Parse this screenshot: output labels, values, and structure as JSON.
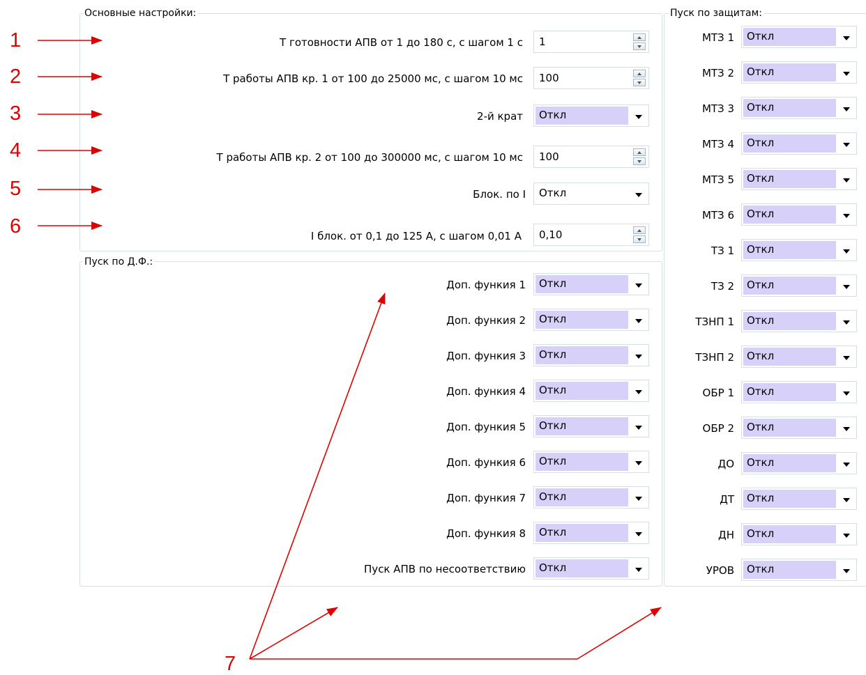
{
  "main_settings": {
    "legend": "Основные настройки:",
    "rows": [
      {
        "label": "Т готовности АПВ от 1 до 180 с, с шагом 1 с",
        "value": "1"
      },
      {
        "label": "Т работы АПВ кр. 1 от 100 до 25000 мс, с шагом 10 мс",
        "value": "100"
      },
      {
        "label": "2-й крат",
        "value": "Откл"
      },
      {
        "label": "Т работы АПВ кр. 2 от 100 до 300000 мс, с шагом 10 мс",
        "value": "100"
      },
      {
        "label": "Блок. по I",
        "value": "Откл"
      },
      {
        "label": "I блок. от 0,1 до 125 А, с шагом 0,01 А",
        "value": "0,10"
      }
    ]
  },
  "df_start": {
    "legend": "Пуск по Д.Ф.:",
    "rows": [
      {
        "label": "Доп. функия 1",
        "value": "Откл"
      },
      {
        "label": "Доп. функия 2",
        "value": "Откл"
      },
      {
        "label": "Доп. функия 3",
        "value": "Откл"
      },
      {
        "label": "Доп. функия 4",
        "value": "Откл"
      },
      {
        "label": "Доп. функия 5",
        "value": "Откл"
      },
      {
        "label": "Доп. функия 6",
        "value": "Откл"
      },
      {
        "label": "Доп. функия 7",
        "value": "Откл"
      },
      {
        "label": "Доп. функия 8",
        "value": "Откл"
      },
      {
        "label": "Пуск АПВ по несоответствию",
        "value": "Откл"
      }
    ]
  },
  "protection_start": {
    "legend": "Пуск по защитам:",
    "rows": [
      {
        "label": "МТЗ 1",
        "value": "Откл"
      },
      {
        "label": "МТЗ 2",
        "value": "Откл"
      },
      {
        "label": "МТЗ 3",
        "value": "Откл"
      },
      {
        "label": "МТЗ 4",
        "value": "Откл"
      },
      {
        "label": "МТЗ 5",
        "value": "Откл"
      },
      {
        "label": "МТЗ 6",
        "value": "Откл"
      },
      {
        "label": "ТЗ 1",
        "value": "Откл"
      },
      {
        "label": "ТЗ 2",
        "value": "Откл"
      },
      {
        "label": "ТЗНП 1",
        "value": "Откл"
      },
      {
        "label": "ТЗНП 2",
        "value": "Откл"
      },
      {
        "label": "ОБР 1",
        "value": "Откл"
      },
      {
        "label": "ОБР 2",
        "value": "Откл"
      },
      {
        "label": "ДО",
        "value": "Откл"
      },
      {
        "label": "ДТ",
        "value": "Откл"
      },
      {
        "label": "ДН",
        "value": "Откл"
      },
      {
        "label": "УРОВ",
        "value": "Откл"
      }
    ]
  },
  "annotations": {
    "numbers": [
      "1",
      "2",
      "3",
      "4",
      "5",
      "6",
      "7"
    ],
    "color": "#e00000"
  },
  "colors": {
    "combo_highlight": "#d7d0f8",
    "frame_border": "#d5dfe5"
  }
}
